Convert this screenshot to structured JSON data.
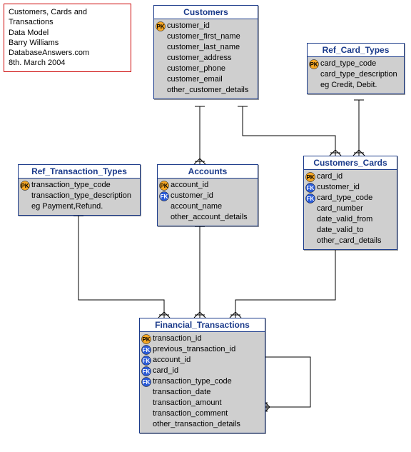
{
  "info": {
    "line1": "Customers, Cards and Transactions",
    "line2": "Data Model",
    "line3": "Barry Williams",
    "line4": "DatabaseAnswers.com",
    "line5": "8th. March 2004"
  },
  "entities": {
    "customers": {
      "title": "Customers",
      "cols": [
        {
          "key": "pk",
          "name": "customer_id"
        },
        {
          "key": "",
          "name": "customer_first_name"
        },
        {
          "key": "",
          "name": "customer_last_name"
        },
        {
          "key": "",
          "name": "customer_address"
        },
        {
          "key": "",
          "name": "customer_phone"
        },
        {
          "key": "",
          "name": "customer_email"
        },
        {
          "key": "",
          "name": "other_customer_details"
        }
      ]
    },
    "ref_card_types": {
      "title": "Ref_Card_Types",
      "cols": [
        {
          "key": "pk",
          "name": "card_type_code"
        },
        {
          "key": "",
          "name": "card_type_description"
        },
        {
          "key": "",
          "name": "eg Credit, Debit."
        }
      ]
    },
    "ref_transaction_types": {
      "title": "Ref_Transaction_Types",
      "cols": [
        {
          "key": "pk",
          "name": "transaction_type_code"
        },
        {
          "key": "",
          "name": "transaction_type_description"
        },
        {
          "key": "",
          "name": "eg Payment,Refund."
        }
      ]
    },
    "accounts": {
      "title": "Accounts",
      "cols": [
        {
          "key": "pk",
          "name": "account_id"
        },
        {
          "key": "fk",
          "name": "customer_id"
        },
        {
          "key": "",
          "name": "account_name"
        },
        {
          "key": "",
          "name": "other_account_details"
        }
      ]
    },
    "customers_cards": {
      "title": "Customers_Cards",
      "cols": [
        {
          "key": "pk",
          "name": "card_id"
        },
        {
          "key": "fk",
          "name": "customer_id"
        },
        {
          "key": "fk",
          "name": "card_type_code"
        },
        {
          "key": "",
          "name": "card_number"
        },
        {
          "key": "",
          "name": "date_valid_from"
        },
        {
          "key": "",
          "name": "date_valid_to"
        },
        {
          "key": "",
          "name": "other_card_details"
        }
      ]
    },
    "financial_transactions": {
      "title": "Financial_Transactions",
      "cols": [
        {
          "key": "pk",
          "name": "transaction_id"
        },
        {
          "key": "fk",
          "name": "previous_transaction_id"
        },
        {
          "key": "fk",
          "name": "account_id"
        },
        {
          "key": "fk",
          "name": "card_id"
        },
        {
          "key": "fk",
          "name": "transaction_type_code"
        },
        {
          "key": "",
          "name": "transaction_date"
        },
        {
          "key": "",
          "name": "transaction_amount"
        },
        {
          "key": "",
          "name": "transaction_comment"
        },
        {
          "key": "",
          "name": "other_transaction_details"
        }
      ]
    }
  }
}
